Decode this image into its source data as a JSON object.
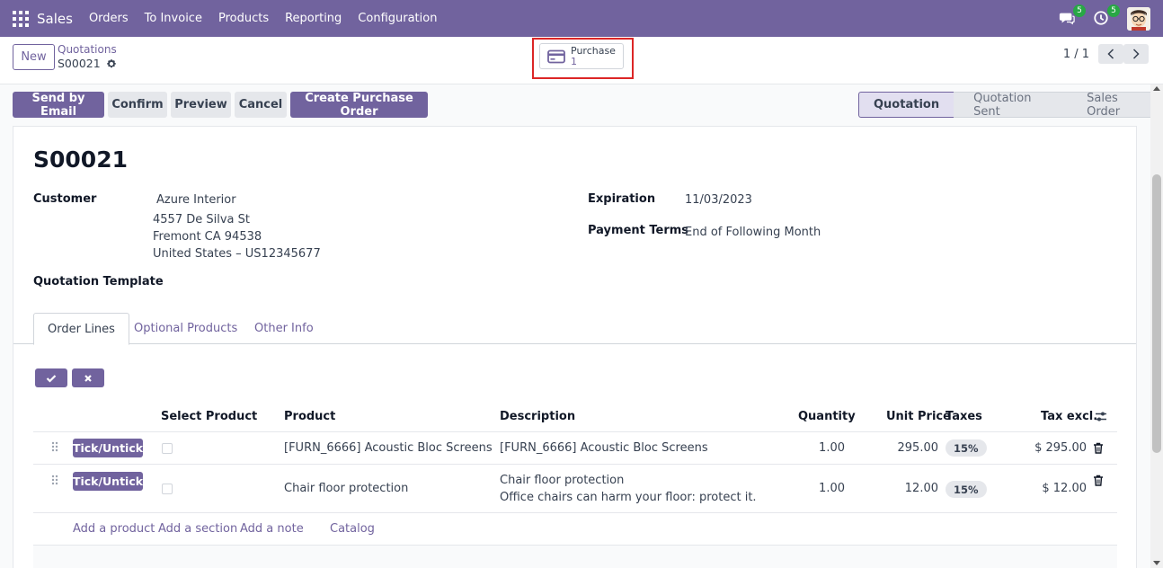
{
  "navbar": {
    "brand": "Sales",
    "menu": [
      "Orders",
      "To Invoice",
      "Products",
      "Reporting",
      "Configuration"
    ],
    "messages_count": "5",
    "activities_count": "5"
  },
  "control_panel": {
    "new_label": "New",
    "breadcrumb_parent": "Quotations",
    "breadcrumb_current": "S00021",
    "smart_button": {
      "label": "Purchase",
      "count": "1"
    },
    "pager": "1 / 1"
  },
  "actions": {
    "send_email": "Send by Email",
    "confirm": "Confirm",
    "preview": "Preview",
    "cancel": "Cancel",
    "create_po": "Create Purchase Order"
  },
  "statusbar": [
    "Quotation",
    "Quotation Sent",
    "Sales Order"
  ],
  "form": {
    "name": "S00021",
    "customer_label": "Customer",
    "customer_name": "Azure Interior",
    "customer_address": [
      "4557 De Silva St",
      "Fremont CA 94538",
      "United States – US12345677"
    ],
    "quotation_template_label": "Quotation Template",
    "expiration_label": "Expiration",
    "expiration_value": "11/03/2023",
    "payment_terms_label": "Payment Terms",
    "payment_terms_value": "End of Following Month"
  },
  "tabs": [
    "Order Lines",
    "Optional Products",
    "Other Info"
  ],
  "table": {
    "headers": {
      "select_product": "Select Product",
      "product": "Product",
      "description": "Description",
      "quantity": "Quantity",
      "unit_price": "Unit Price",
      "taxes": "Taxes",
      "tax_excl": "Tax excl."
    },
    "rows": [
      {
        "button": "Tick/Untick",
        "product": "[FURN_6666] Acoustic Bloc Screens",
        "description": "[FURN_6666] Acoustic Bloc Screens",
        "description2": "",
        "quantity": "1.00",
        "unit_price": "295.00",
        "tax": "15%",
        "subtotal": "$ 295.00"
      },
      {
        "button": "Tick/Untick",
        "product": "Chair floor protection",
        "description": "Chair floor protection",
        "description2": "Office chairs can harm your floor: protect it.",
        "quantity": "1.00",
        "unit_price": "12.00",
        "tax": "15%",
        "subtotal": "$ 12.00"
      }
    ],
    "add_links": [
      "Add a product",
      "Add a section",
      "Add a note",
      "Catalog"
    ]
  },
  "colors": {
    "brand": "#71639e",
    "highlight": "#dc2626",
    "badge": "#28a745"
  }
}
